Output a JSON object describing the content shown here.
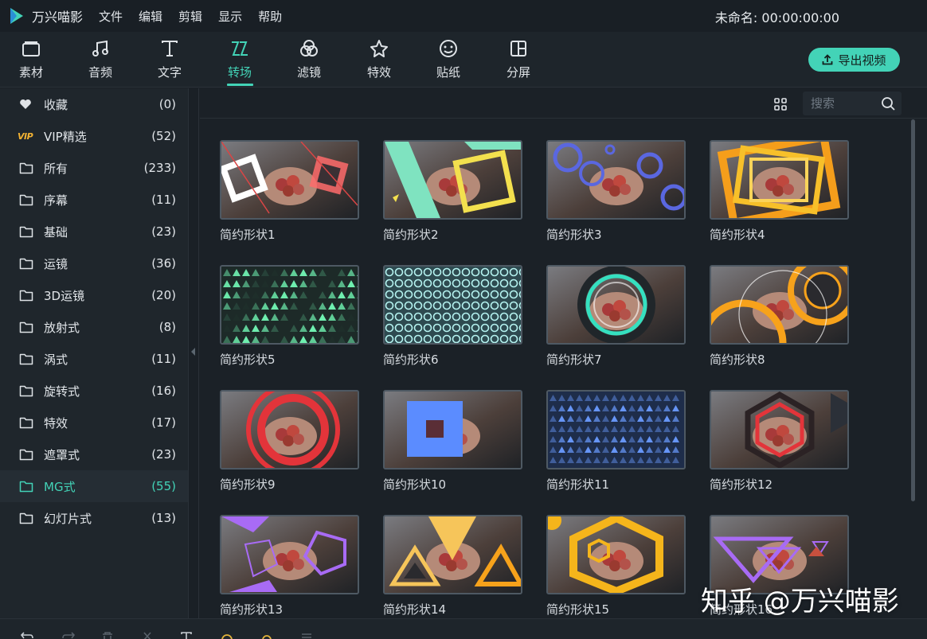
{
  "app": {
    "name": "万兴喵影",
    "project_title": "未命名: 00:00:00:00"
  },
  "menu": [
    "文件",
    "编辑",
    "剪辑",
    "显示",
    "帮助"
  ],
  "toolbar": {
    "tools": [
      {
        "label": "素材",
        "icon": "folder-media-icon"
      },
      {
        "label": "音频",
        "icon": "music-note-icon"
      },
      {
        "label": "文字",
        "icon": "text-icon"
      },
      {
        "label": "转场",
        "icon": "transition-icon",
        "active": true
      },
      {
        "label": "滤镜",
        "icon": "filter-icon"
      },
      {
        "label": "特效",
        "icon": "effects-star-icon"
      },
      {
        "label": "贴纸",
        "icon": "sticker-icon"
      },
      {
        "label": "分屏",
        "icon": "split-screen-icon"
      }
    ],
    "export_label": "导出视频"
  },
  "categories": [
    {
      "label": "收藏",
      "count": "(0)",
      "icon": "heart-icon"
    },
    {
      "label": "VIP精选",
      "count": "(52)",
      "icon": "vip-icon",
      "icon_text": "VIP"
    },
    {
      "label": "所有",
      "count": "(233)",
      "icon": "folder-icon"
    },
    {
      "label": "序幕",
      "count": "(11)",
      "icon": "folder-icon"
    },
    {
      "label": "基础",
      "count": "(23)",
      "icon": "folder-icon"
    },
    {
      "label": "运镜",
      "count": "(36)",
      "icon": "folder-icon"
    },
    {
      "label": "3D运镜",
      "count": "(20)",
      "icon": "folder-icon"
    },
    {
      "label": "放射式",
      "count": "(8)",
      "icon": "folder-icon"
    },
    {
      "label": "涡式",
      "count": "(11)",
      "icon": "folder-icon"
    },
    {
      "label": "旋转式",
      "count": "(16)",
      "icon": "folder-icon"
    },
    {
      "label": "特效",
      "count": "(17)",
      "icon": "folder-icon"
    },
    {
      "label": "遮罩式",
      "count": "(23)",
      "icon": "folder-icon"
    },
    {
      "label": "MG式",
      "count": "(55)",
      "icon": "folder-icon",
      "active": true
    },
    {
      "label": "幻灯片式",
      "count": "(13)",
      "icon": "folder-icon"
    }
  ],
  "search": {
    "placeholder": "搜索"
  },
  "transitions": [
    "简约形状1",
    "简约形状2",
    "简约形状3",
    "简约形状4",
    "简约形状5",
    "简约形状6",
    "简约形状7",
    "简约形状8",
    "简约形状9",
    "简约形状10",
    "简约形状11",
    "简约形状12",
    "简约形状13",
    "简约形状14",
    "简约形状15",
    "简约形状16"
  ],
  "watermark": "知乎 @万兴喵影",
  "colors": {
    "accent": "#43d3b7",
    "background": "#1b2127",
    "panel": "#1f262c"
  }
}
